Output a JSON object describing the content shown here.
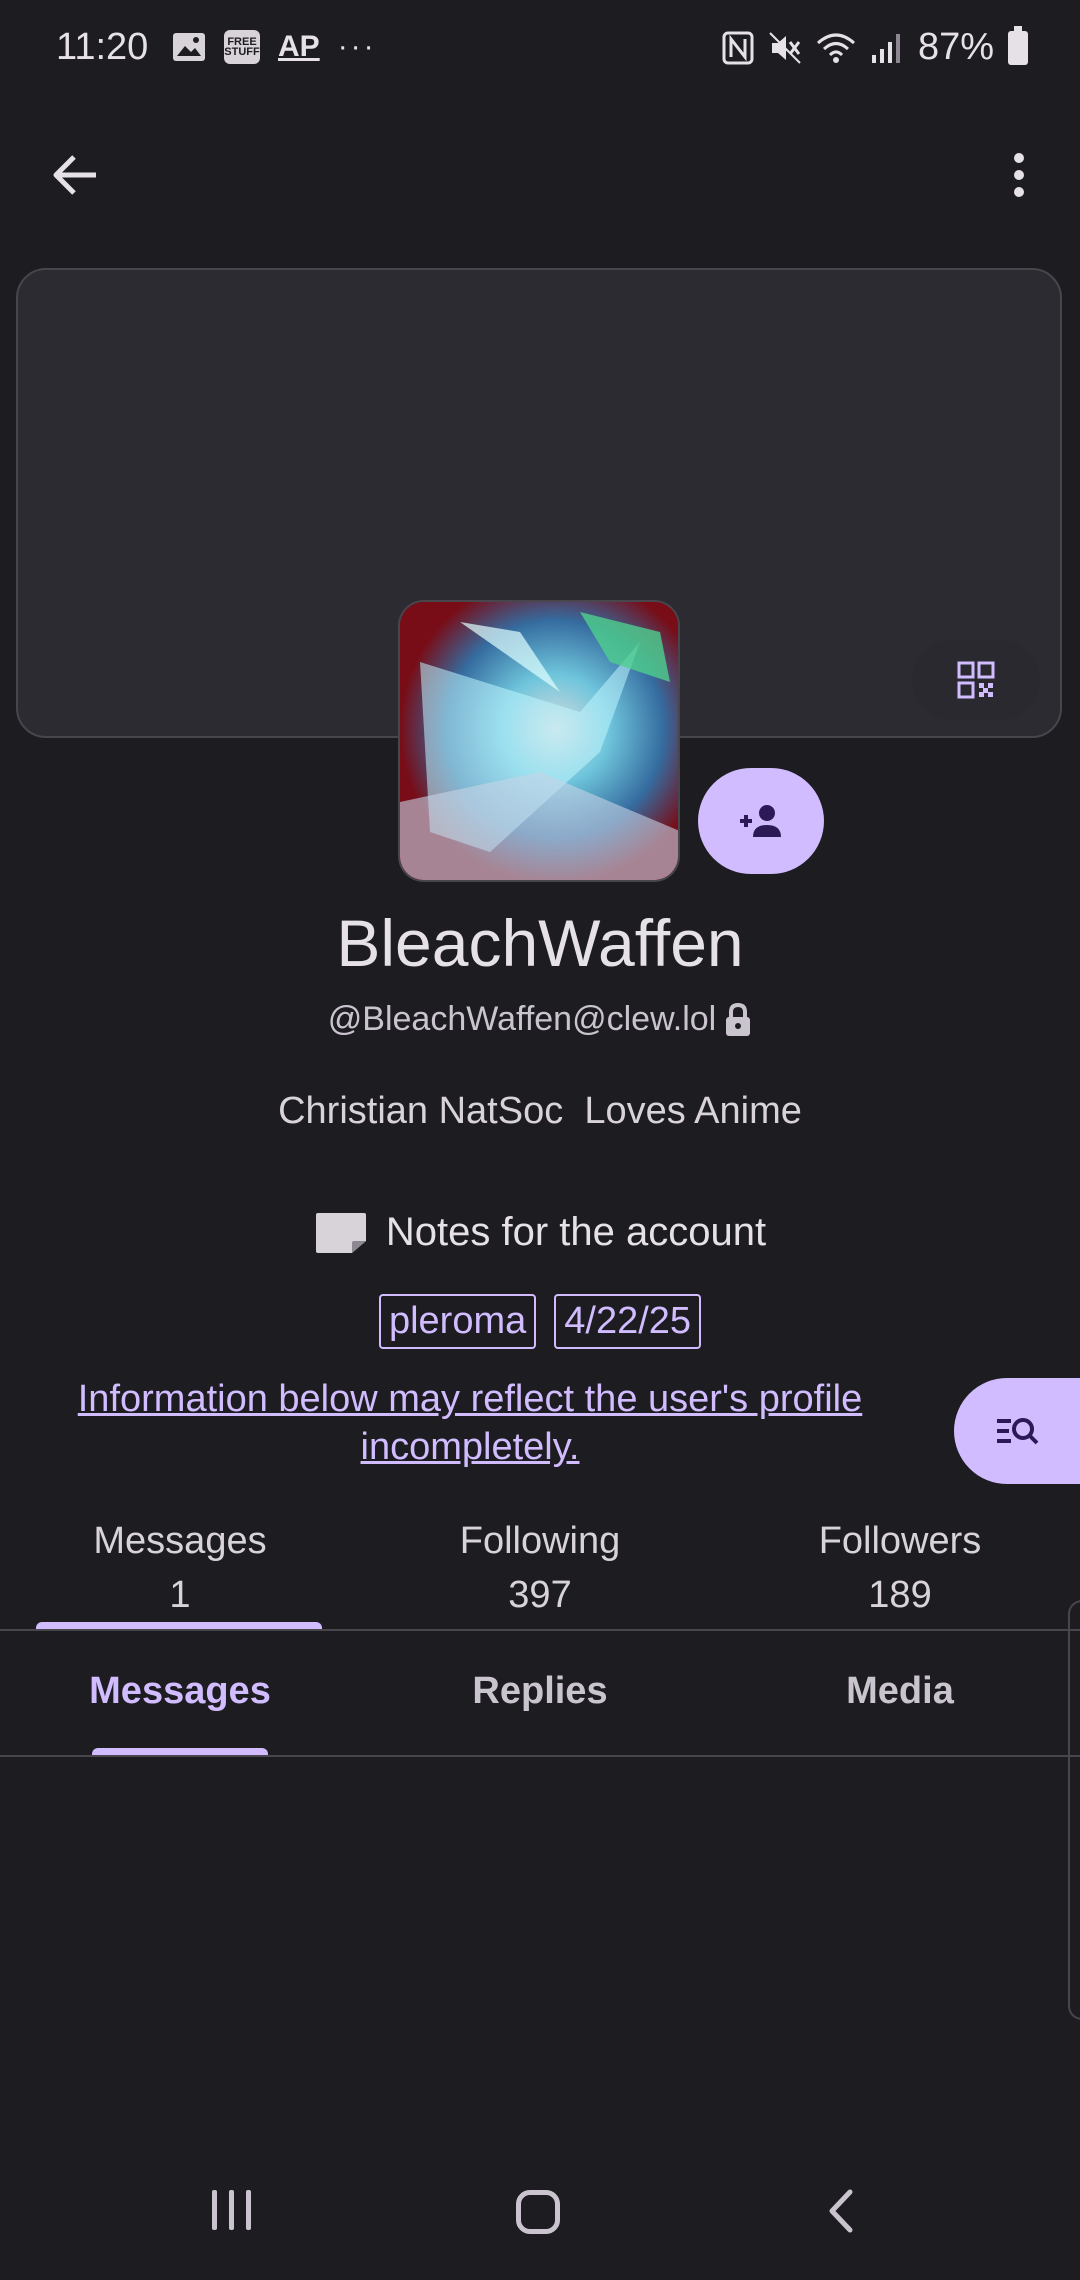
{
  "status_bar": {
    "time": "11:20",
    "free_stuff_label": "FREE STUFF",
    "ap_label": "AP",
    "more_dots": "···",
    "battery": "87%"
  },
  "toolbar": {
    "back_icon": "arrow-left-icon",
    "menu_icon": "more-vert-icon"
  },
  "profile": {
    "display_name": "BleachWaffen",
    "handle": "@BleachWaffen@clew.lol",
    "bio": "Christian NatSoc  Loves Anime",
    "notes_label": "Notes for the account",
    "tags": [
      "pleroma",
      "4/22/25"
    ],
    "info_notice": "Information below may reflect the user's profile incompletely."
  },
  "stats": [
    {
      "label": "Messages",
      "value": "1"
    },
    {
      "label": "Following",
      "value": "397"
    },
    {
      "label": "Followers",
      "value": "189"
    }
  ],
  "tabs": [
    {
      "label": "Messages",
      "active": true
    },
    {
      "label": "Replies",
      "active": false
    },
    {
      "label": "Media",
      "active": false
    }
  ],
  "colors": {
    "background": "#1d1c20",
    "accent": "#d0bcff",
    "card": "#2c2b31"
  }
}
